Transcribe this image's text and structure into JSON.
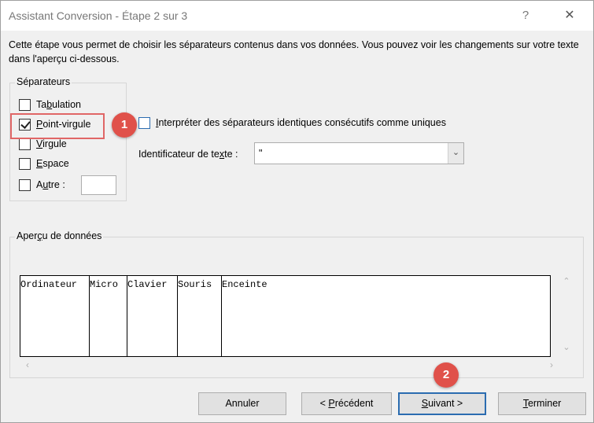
{
  "window": {
    "title": "Assistant Conversion - Étape 2 sur 3",
    "help_glyph": "?",
    "close_glyph": "✕"
  },
  "description": "Cette étape vous permet de choisir les séparateurs contenus dans vos données. Vous pouvez voir les changements sur votre texte dans l'aperçu ci-dessous.",
  "separators": {
    "legend": "Séparateurs",
    "items": [
      {
        "label_pre": "Ta",
        "label_u": "b",
        "label_post": "ulation",
        "checked": false
      },
      {
        "label_pre": "",
        "label_u": "P",
        "label_post": "oint-virgule",
        "checked": true
      },
      {
        "label_pre": "",
        "label_u": "V",
        "label_post": "irgule",
        "checked": false
      },
      {
        "label_pre": "",
        "label_u": "E",
        "label_post": "space",
        "checked": false
      },
      {
        "label_pre": "A",
        "label_u": "u",
        "label_post": "tre :",
        "checked": false
      }
    ],
    "other_value": ""
  },
  "consecutive": {
    "label_u": "I",
    "label_post": "nterpréter des séparateurs identiques consécutifs comme uniques",
    "checked": false
  },
  "qualifier": {
    "label_pre": "Identificateur de te",
    "label_u": "x",
    "label_post": "te :",
    "value": "\""
  },
  "preview": {
    "legend_pre": "Aper",
    "legend_u": "ç",
    "legend_post": "u de données",
    "columns": [
      "Ordinateur",
      "Micro",
      "Clavier",
      "Souris",
      "Enceinte"
    ]
  },
  "annotations": {
    "badge1": "1",
    "badge2": "2"
  },
  "buttons": {
    "cancel": "Annuler",
    "previous_pre": "< ",
    "previous_u": "P",
    "previous_post": "récédent",
    "next_u": "S",
    "next_post": "uivant >",
    "finish_u": "T",
    "finish_post": "erminer"
  },
  "colors": {
    "accent": "#2b6cb0",
    "badge": "#e0514a",
    "highlight": "#e06666"
  }
}
